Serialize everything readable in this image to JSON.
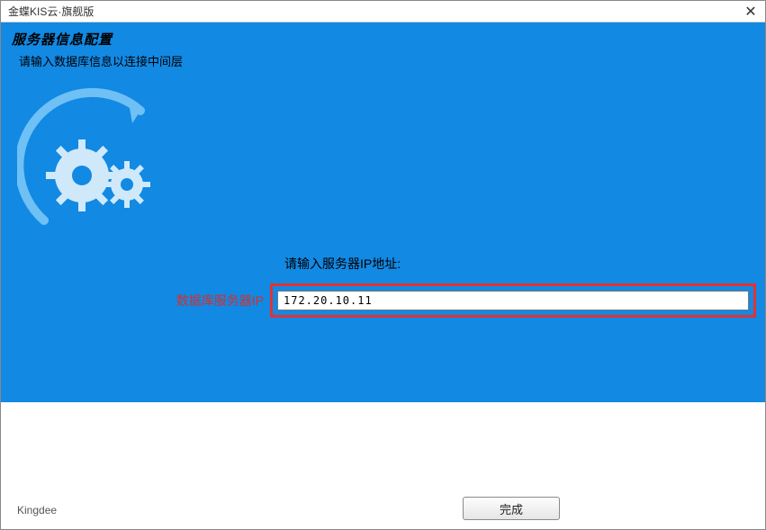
{
  "window": {
    "title": "金蝶KIS云·旗舰版"
  },
  "header": {
    "title": "服务器信息配置",
    "subtitle": "请输入数据库信息以连接中间层"
  },
  "form": {
    "prompt": "请输入服务器IP地址:",
    "field_label": "数据库服务器IP",
    "ip_value": "172.20.10.11"
  },
  "footer": {
    "brand": "Kingdee",
    "finish_label": "完成"
  },
  "colors": {
    "panel_blue": "#1289e3",
    "highlight_red": "#e33232"
  }
}
